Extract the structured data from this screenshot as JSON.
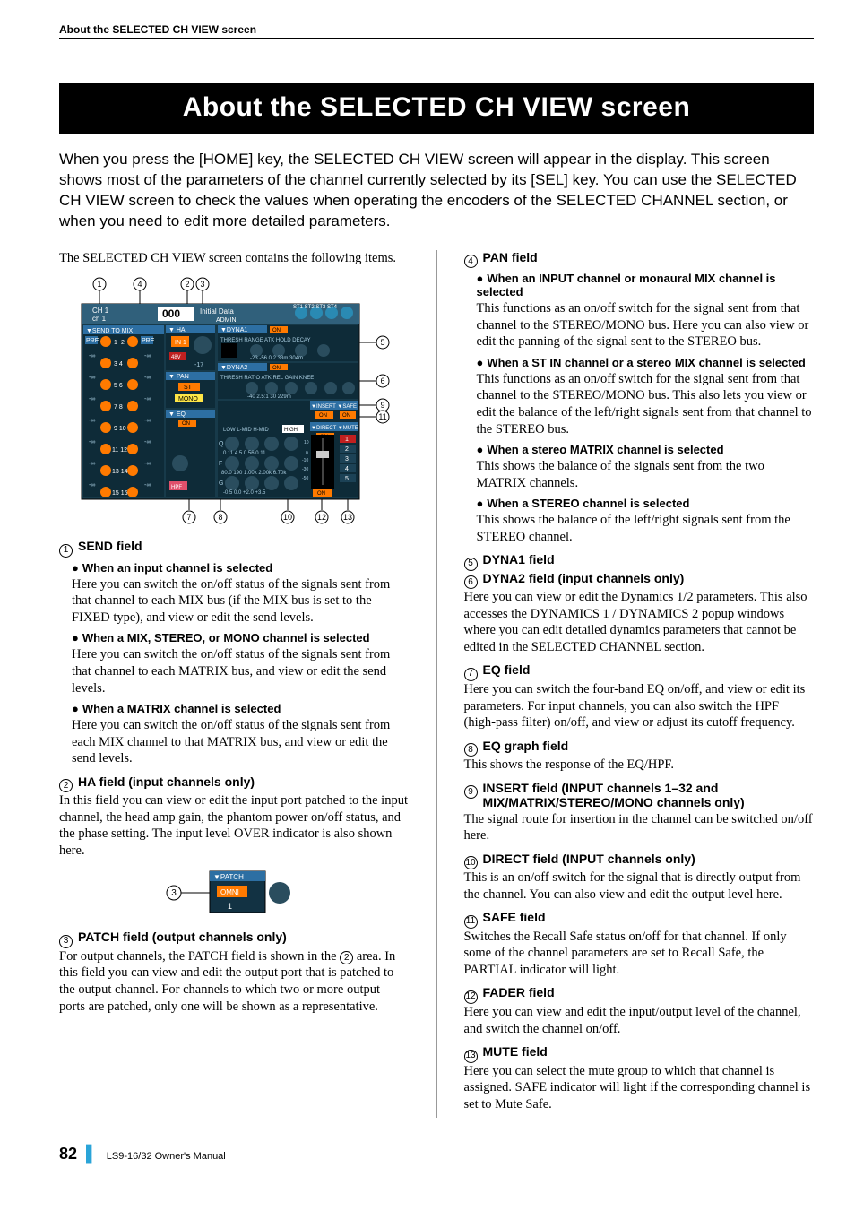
{
  "running_head": "About the SELECTED CH VIEW screen",
  "title": "About the SELECTED CH VIEW screen",
  "intro": "When you press the [HOME] key, the SELECTED CH VIEW screen will appear in the display. This screen shows most of the parameters of the channel currently selected by its [SEL] key. You can use the SELECTED CH VIEW screen to check the values when operating the encoders of the SELECTED CHANNEL section, or when you need to edit more detailed parameters.",
  "left": {
    "lead": "The SELECTED CH VIEW screen contains the following items.",
    "callouts_top": [
      "1",
      "4",
      "2",
      "3"
    ],
    "callouts_right": [
      "5",
      "6",
      "9",
      "11"
    ],
    "callouts_bottom": [
      "7",
      "8",
      "10",
      "12",
      "13"
    ],
    "send": {
      "num": "1",
      "label": "SEND field",
      "b1_label": "When an input channel is selected",
      "b1_text": "Here you can switch the on/off status of the signals sent from that channel to each MIX bus (if the MIX bus is set to the FIXED type), and view or edit the send levels.",
      "b2_label": "When a MIX, STEREO, or MONO channel is selected",
      "b2_text": "Here you can switch the on/off status of the signals sent from that channel to each MATRIX bus, and view or edit the send levels.",
      "b3_label": "When a MATRIX channel is selected",
      "b3_text": "Here you can switch the on/off status of the signals sent from each MIX channel to that MATRIX bus, and view or edit the send levels."
    },
    "ha": {
      "num": "2",
      "label": "HA field (input channels only)",
      "text": "In this field you can view or edit the input port patched to the input channel, the head amp gain, the phantom power on/off status, and the phase setting. The input level OVER indicator is also shown here."
    },
    "fig2_callout": "3",
    "patch": {
      "num": "3",
      "label": "PATCH field (output channels only)",
      "text_a": "For output channels, the PATCH field is shown in the ",
      "text_b": " area. In this field you can view and edit the output port that is patched to the output channel. For channels to which two or more output ports are patched, only one will be shown as a representative.",
      "inline_ref": "2"
    }
  },
  "right": {
    "pan": {
      "num": "4",
      "label": "PAN field",
      "b1_label": "When an INPUT channel or monaural MIX channel is selected",
      "b1_text": "This functions as an on/off switch for the signal sent from that channel to the STEREO/MONO bus. Here you can also view or edit the panning of the signal sent to the STEREO bus.",
      "b2_label": "When a ST IN channel or a stereo MIX channel is selected",
      "b2_text": "This functions as an on/off switch for the signal sent from that channel to the STEREO/MONO bus. This also lets you view or edit the balance of the left/right signals sent from that channel to the STEREO bus.",
      "b3_label": "When a stereo MATRIX channel is selected",
      "b3_text": "This shows the balance of the signals sent from the two MATRIX channels.",
      "b4_label": "When a STEREO channel is selected",
      "b4_text": "This shows the balance of the left/right signals sent from the STEREO channel."
    },
    "dyna1": {
      "num": "5",
      "label": "DYNA1 field"
    },
    "dyna2": {
      "num": "6",
      "label": "DYNA2 field (input channels only)",
      "text": "Here you can view or edit the Dynamics 1/2 parameters. This also accesses the DYNAMICS 1 / DYNAMICS 2 popup windows where you can edit detailed dynamics parameters that cannot be edited in the SELECTED CHANNEL section."
    },
    "eq": {
      "num": "7",
      "label": "EQ field",
      "text": "Here you can switch the four-band EQ on/off, and view or edit its parameters. For input channels, you can also switch the HPF (high-pass filter) on/off, and view or adjust its cutoff frequency."
    },
    "eqgraph": {
      "num": "8",
      "label": "EQ graph field",
      "text": "This shows the response of the EQ/HPF."
    },
    "insert": {
      "num": "9",
      "label": "INSERT field (INPUT channels 1–32 and MIX/MATRIX/STEREO/MONO channels only)",
      "text": "The signal route for insertion in the channel can be switched on/off here."
    },
    "direct": {
      "num": "10",
      "label": "DIRECT field (INPUT channels only)",
      "text": "This is an on/off switch for the signal that is directly output from the channel. You can also view and edit the output level here."
    },
    "safe": {
      "num": "11",
      "label": "SAFE field",
      "text": "Switches the Recall Safe status on/off for that channel. If only some of the channel parameters are set to Recall Safe, the PARTIAL indicator will light."
    },
    "fader": {
      "num": "12",
      "label": "FADER field",
      "text": "Here you can view and edit the input/output level of the channel, and switch the channel on/off."
    },
    "mute": {
      "num": "13",
      "label": "MUTE field",
      "text": "Here you can select the mute group to which that channel is assigned. SAFE indicator will light if the corresponding channel is set to Mute Safe."
    }
  },
  "footer": {
    "page": "82",
    "manual": "LS9-16/32  Owner's Manual"
  }
}
